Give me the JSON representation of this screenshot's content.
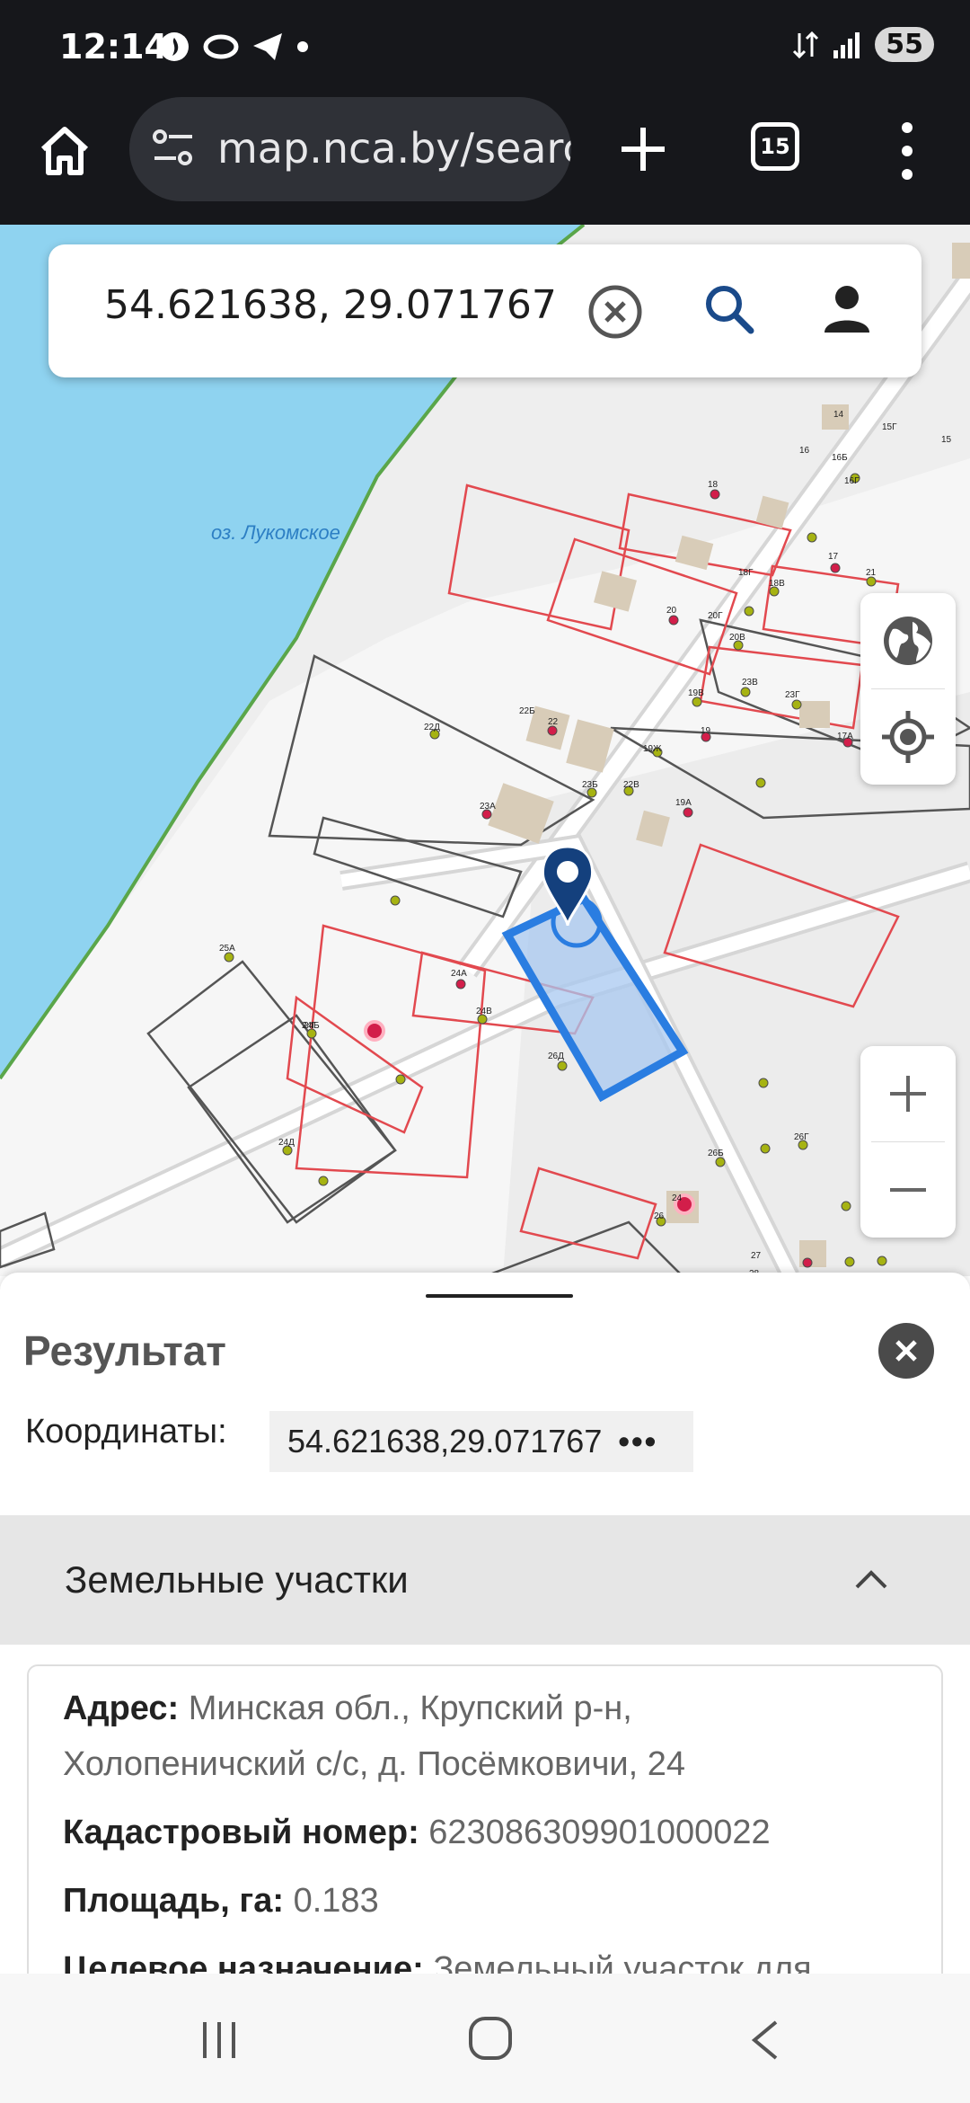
{
  "status": {
    "time": "12:14",
    "battery": "55"
  },
  "browser": {
    "url": "map.nca.by/search",
    "tab_count": "15"
  },
  "search": {
    "value": "54.621638, 29.071767"
  },
  "map": {
    "lake_label": "оз. Лукомское",
    "house_numbers": [
      "14",
      "15",
      "15Г",
      "16",
      "16Б",
      "16Г",
      "17",
      "17А",
      "18",
      "18Г",
      "18В",
      "19",
      "19А",
      "19Ж",
      "19В",
      "20",
      "20Г",
      "20В",
      "21",
      "22",
      "22Б",
      "22В",
      "22Д",
      "23А",
      "23Б",
      "23В",
      "23Г",
      "24",
      "24А",
      "24Б",
      "24В",
      "24Г",
      "24Д",
      "25А",
      "26",
      "26Б",
      "26Г",
      "26Д",
      "27",
      "28"
    ]
  },
  "result": {
    "title": "Результат",
    "coords_label": "Координаты:",
    "coords_value": "54.621638,29.071767",
    "section_title": "Земельные участки",
    "address_label": "Адрес:",
    "address_line1": "Минская обл., Крупский р-н,",
    "address_line2": "Холопеничский с/с, д. Посёмковичи, 24",
    "cadastral_label": "Кадастровый номер:",
    "cadastral_value": "623086309901000022",
    "area_label": "Площадь, га:",
    "area_value": "0.183",
    "purpose_label": "Целевое назначение:",
    "purpose_value": "Земельный участок для"
  }
}
